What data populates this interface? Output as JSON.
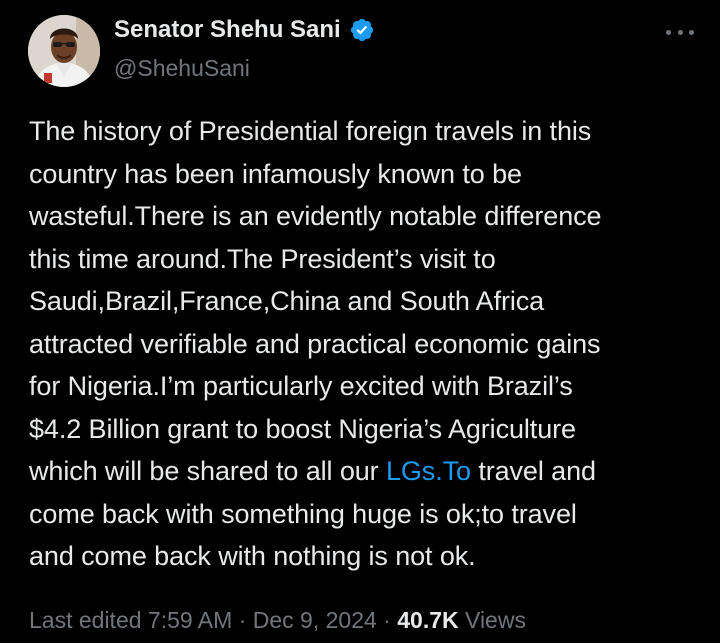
{
  "author": {
    "display_name": "Senator Shehu Sani",
    "handle": "@ShehuSani",
    "verified": true,
    "verified_color": "#1d9bf0"
  },
  "menu": {
    "icon": "more-horizontal-icon"
  },
  "tweet": {
    "lines": [
      "The history of Presidential foreign travels in this",
      "country has been infamously known to be",
      "wasteful.There is an evidently notable difference",
      "this time around.The President’s visit to",
      "Saudi,Brazil,France,China and South Africa",
      "attracted verifiable and practical economic gains",
      "for Nigeria.I’m particularly excited with Brazil’s",
      "$4.2 Billion grant to boost Nigeria’s Agriculture"
    ],
    "line9_before": "which will be shared to all our ",
    "line9_link": "LGs.To",
    "line9_after": " travel and",
    "line10": "come back with something huge is ok;to travel",
    "line11": "and come back with nothing is not ok."
  },
  "meta": {
    "edited_label": "Last edited",
    "time": "7:59 AM",
    "separator": " · ",
    "date": "Dec 9, 2024",
    "views_count": "40.7K",
    "views_label": "Views"
  },
  "colors": {
    "background": "#000000",
    "text": "#e7e9ea",
    "secondary": "#71767b",
    "link": "#1d9bf0"
  }
}
